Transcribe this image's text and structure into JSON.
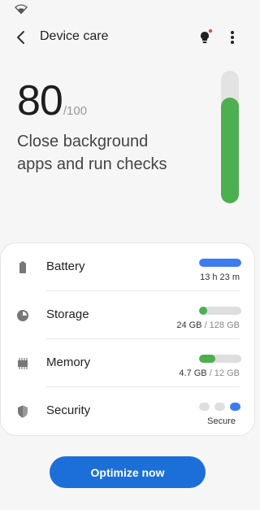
{
  "header": {
    "title": "Device care",
    "back_icon": "back-arrow-icon",
    "tips_icon": "lightbulb-icon",
    "more_icon": "more-vert-icon"
  },
  "score": {
    "value": "80",
    "max": "/100",
    "fraction": 0.8,
    "advice": "Close background apps and run checks"
  },
  "items": [
    {
      "label": "Battery",
      "icon": "battery-icon",
      "value": "13 h 23 m",
      "total": "",
      "fill": 1.0,
      "color": "#3d7bf0"
    },
    {
      "label": "Storage",
      "icon": "storage-pie-icon",
      "value": "24 GB",
      "total": " / 128 GB",
      "fill": 0.19,
      "color": "#4caf50"
    },
    {
      "label": "Memory",
      "icon": "memory-chip-icon",
      "value": "4.7 GB",
      "total": " / 12 GB",
      "fill": 0.39,
      "color": "#4caf50"
    },
    {
      "label": "Security",
      "icon": "shield-icon",
      "value": "Secure",
      "total": "",
      "color": "#3d7bf0"
    }
  ],
  "optimize_label": "Optimize now",
  "colors": {
    "accent": "#1c6fd9",
    "good": "#4caf50",
    "gauge_track": "#e3e3e3"
  }
}
